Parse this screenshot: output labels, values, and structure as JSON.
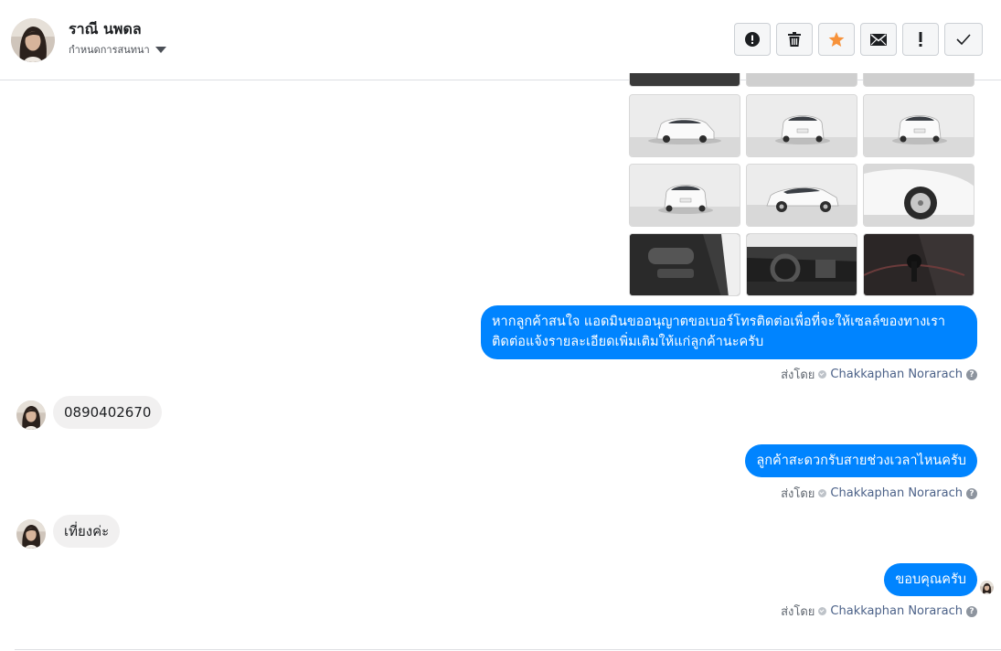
{
  "header": {
    "contact_name": "ราณี นพดล",
    "assign_label": "กำหนดการสนทนา",
    "actions": [
      {
        "name": "report-button",
        "icon": "alert-circle-icon"
      },
      {
        "name": "delete-button",
        "icon": "trash-icon"
      },
      {
        "name": "star-button",
        "icon": "star-icon"
      },
      {
        "name": "mark-unread-button",
        "icon": "envelope-icon"
      },
      {
        "name": "follow-up-button",
        "icon": "exclamation-icon"
      },
      {
        "name": "done-button",
        "icon": "checkmark-icon"
      }
    ]
  },
  "colors": {
    "outgoing_bubble": "#0084ff",
    "incoming_bubble": "#f1f0f0",
    "star": "#f7923a",
    "agent_link": "#4b6188"
  },
  "photos": [
    {
      "name": "car-photo-front-left"
    },
    {
      "name": "car-photo-rear-right"
    },
    {
      "name": "car-photo-rear"
    },
    {
      "name": "car-photo-rear-left"
    },
    {
      "name": "car-photo-side"
    },
    {
      "name": "car-photo-wheel-closeup"
    },
    {
      "name": "car-photo-door-interior"
    },
    {
      "name": "car-photo-dashboard"
    },
    {
      "name": "car-photo-gear-shifter"
    }
  ],
  "messages": [
    {
      "direction": "outgoing",
      "lines": [
        "หากลูกค้าสนใจ แอดมินขออนุญาตขอเบอร์โทรติดต่อเพื่อที่จะให้เซลล์ของทางเรา",
        "ติดต่อแจ้งรายละเอียดเพิ่มเติมให้แก่ลูกค้านะครับ"
      ],
      "sent_by_label": "ส่งโดย",
      "agent": "Chakkaphan Norarach"
    },
    {
      "direction": "incoming",
      "text": "0890402670"
    },
    {
      "direction": "outgoing",
      "text": "ลูกค้าสะดวกรับสายช่วงเวลาไหนครับ",
      "sent_by_label": "ส่งโดย",
      "agent": "Chakkaphan Norarach"
    },
    {
      "direction": "incoming",
      "text": "เที่ยงค่ะ"
    },
    {
      "direction": "outgoing",
      "text": "ขอบคุณครับ",
      "sent_by_label": "ส่งโดย",
      "agent": "Chakkaphan Norarach"
    }
  ]
}
